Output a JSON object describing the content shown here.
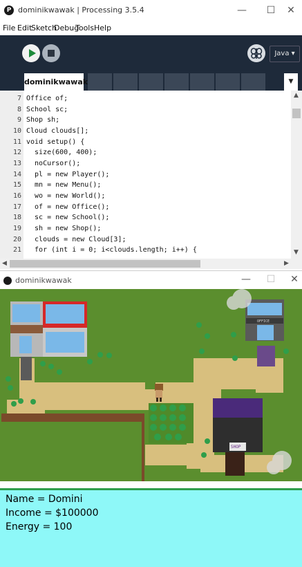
{
  "ide": {
    "title": "dominikwawak | Processing 3.5.4",
    "app_icon_glyph": "P",
    "menu": [
      "File",
      "Edit",
      "Sketch",
      "Debug",
      "Tools",
      "Help"
    ],
    "mode": "Java ▾",
    "active_tab": "dominikwawak",
    "tab_menu_glyph": "▼",
    "window_controls": {
      "minimize": "—",
      "maximize": "☐",
      "close": "✕"
    },
    "line_numbers": [
      "7",
      "8",
      "9",
      "10",
      "11",
      "12",
      "13",
      "14",
      "15",
      "16",
      "17",
      "18",
      "19",
      "20",
      "21"
    ],
    "code_lines": [
      "Office of;",
      "School sc;",
      "Shop sh;",
      "Cloud clouds[];",
      "void setup() {",
      "  size(600, 400);",
      "  noCursor();",
      "  pl = new Player();",
      "  mn = new Menu();",
      "  wo = new World();",
      "  of = new Office();",
      "  sc = new School();",
      "  sh = new Shop();",
      "  clouds = new Cloud[3];",
      "  for (int i = 0; i<clouds.length; i++) {"
    ]
  },
  "sketch": {
    "title": "dominikwawak",
    "window_controls": {
      "minimize": "—",
      "maximize": "☐",
      "close": "✕"
    },
    "scene_labels": {
      "office_sign": "OFFICE",
      "shop_sign": "SHOP"
    },
    "info": {
      "name_line": "Name = Domini",
      "income_line": "Income = $100000",
      "energy_line": "Energy = 100"
    }
  },
  "colors": {
    "toolbar_bg": "#1e2a3a",
    "grass": "#5b8e2e",
    "path": "#d8bf7e",
    "info_bg": "#8ef8f8",
    "run_green": "#1c8a3a"
  }
}
